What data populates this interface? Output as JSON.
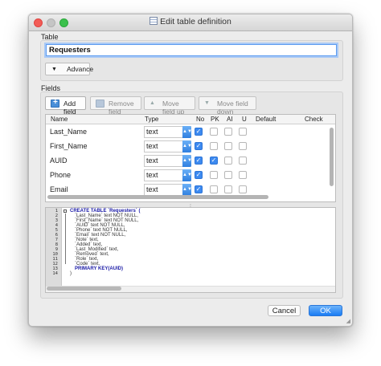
{
  "window": {
    "title": "Edit table definition"
  },
  "table_section": {
    "label": "Table",
    "name_value": "Requesters",
    "advance_label": "Advance"
  },
  "fields_section": {
    "label": "Fields",
    "toolbar": {
      "add": "Add field",
      "remove": "Remove field",
      "up": "Move field up",
      "down": "Move field down"
    },
    "columns": [
      "Name",
      "Type",
      "No",
      "PK",
      "AI",
      "U",
      "Default",
      "Check"
    ],
    "rows": [
      {
        "name": "Last_Name",
        "type": "text",
        "nn": true,
        "pk": false,
        "ai": false,
        "u": false
      },
      {
        "name": "First_Name",
        "type": "text",
        "nn": true,
        "pk": false,
        "ai": false,
        "u": false
      },
      {
        "name": "AUID",
        "type": "text",
        "nn": true,
        "pk": true,
        "ai": false,
        "u": false
      },
      {
        "name": "Phone",
        "type": "text",
        "nn": true,
        "pk": false,
        "ai": false,
        "u": false
      },
      {
        "name": "Email",
        "type": "text",
        "nn": true,
        "pk": false,
        "ai": false,
        "u": false
      }
    ]
  },
  "sql": {
    "line_numbers": [
      "1",
      "2",
      "3",
      "4",
      "5",
      "6",
      "7",
      "8",
      "9",
      "10",
      "11",
      "12",
      "13",
      "14"
    ],
    "lines": [
      "CREATE TABLE `Requesters` (",
      "`Last_Name` text NOT NULL,",
      "`First_Name` text NOT NULL,",
      "`AUID` text NOT NULL,",
      "`Phone` text NOT NULL,",
      "`Email` text NOT NULL,",
      "`Note` text,",
      "`Added` text,",
      "`Last_Modified` text,",
      "`Removed` text,",
      "`Role` text,",
      "`Code` text,",
      "PRIMARY KEY(AUID)",
      ")"
    ]
  },
  "footer": {
    "cancel": "Cancel",
    "ok": "OK"
  },
  "colors": {
    "accent": "#3d8af0",
    "ok_button": "#1a7cf4"
  }
}
